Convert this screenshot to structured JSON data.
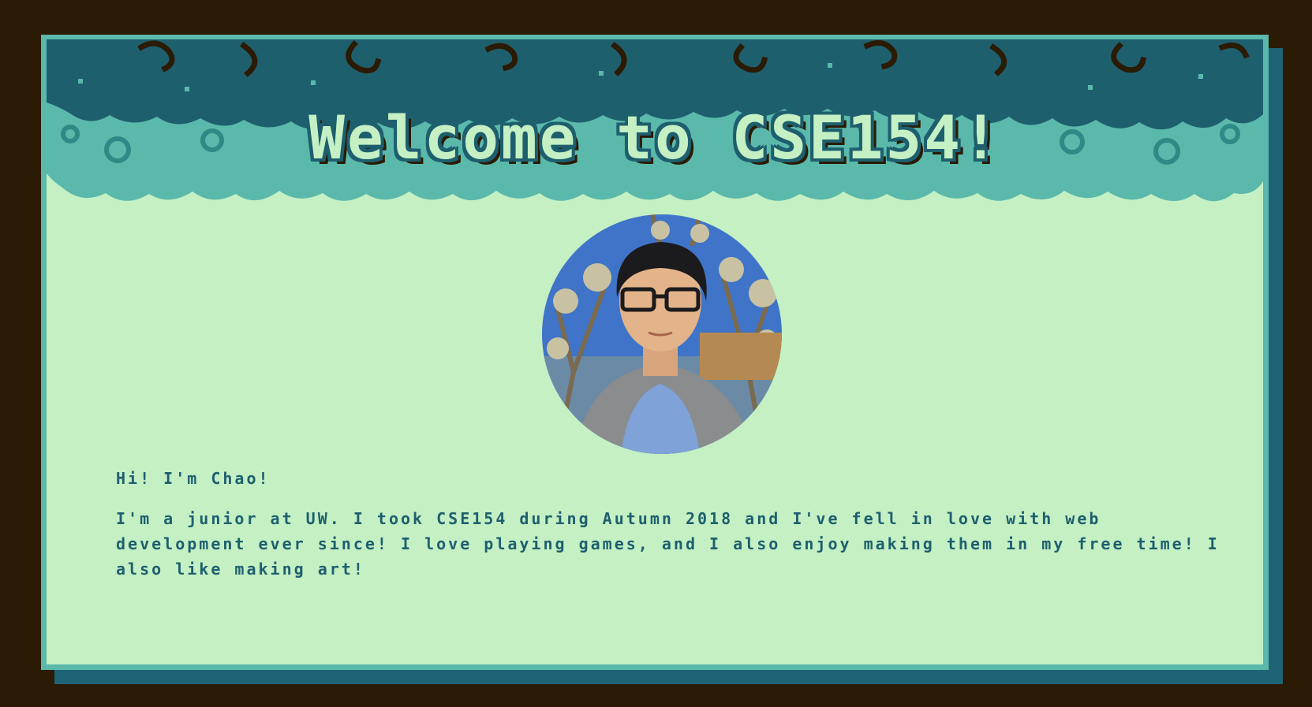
{
  "header": {
    "title": "Welcome to CSE154!"
  },
  "profile": {
    "photo_alt": "photo of Chao",
    "greeting": "Hi! I'm Chao!",
    "bio": "I'm a junior at UW. I took CSE154 during Autumn 2018 and I've fell in love with web development ever since! I love playing games, and I also enjoy making them in my free time! I also like making art!"
  },
  "colors": {
    "background": "#2b1a04",
    "card": "#c4f0c4",
    "border": "#5ab9ab",
    "dark_teal": "#1e5f6e",
    "shadow": "#1f6475"
  }
}
